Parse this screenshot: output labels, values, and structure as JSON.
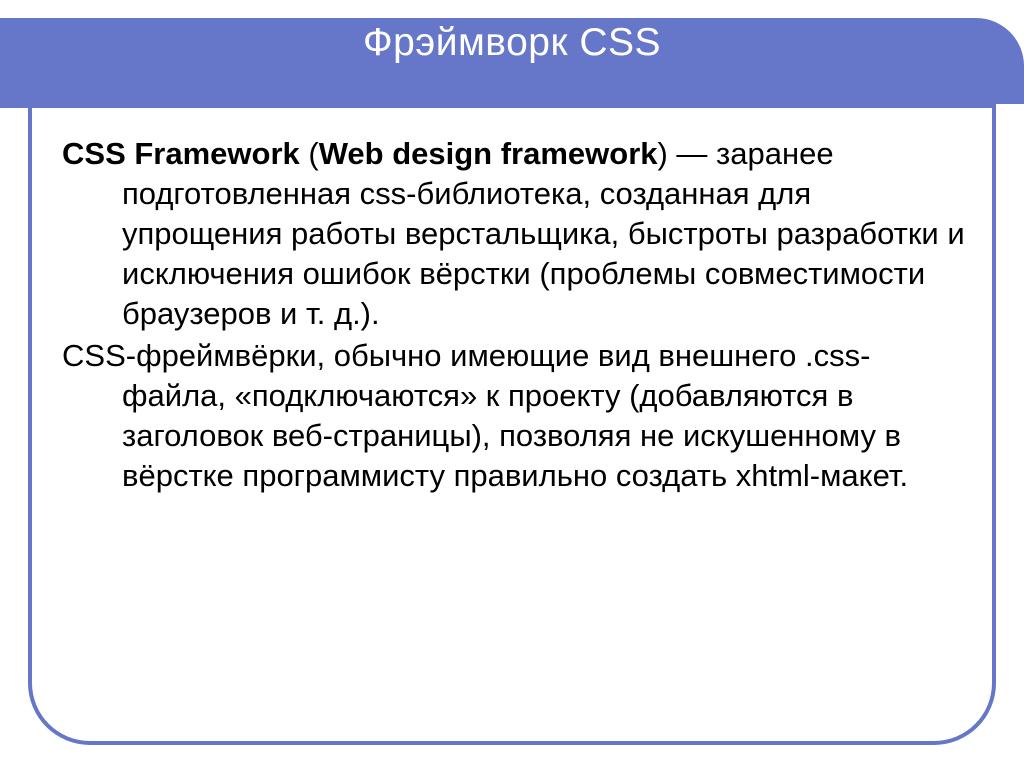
{
  "header": {
    "title": "Фрэймворк CSS"
  },
  "content": {
    "p1": {
      "bold1": "CSS Framework",
      "open_paren": " (",
      "bold2": "Web design framework",
      "rest": ") — заранее подготовленная css-библиотека, созданная для упрощения работы верстальщика, быстроты разработки и исключения ошибок вёрстки (проблемы совместимости браузеров и т. д.)."
    },
    "p2": "CSS-фреймвёрки, обычно имеющие вид внешнего .css-файла, «подключаются» к проекту (добавляются в заголовок веб-страницы), позволяя не искушенному в вёрстке программисту правильно создать xhtml-макет."
  }
}
